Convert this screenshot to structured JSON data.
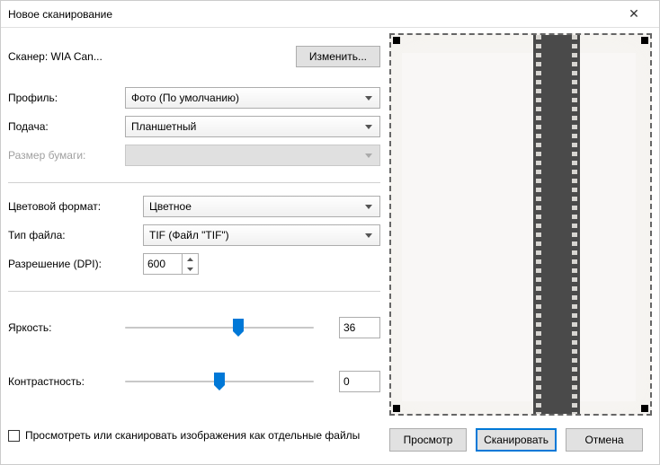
{
  "window": {
    "title": "Новое сканирование"
  },
  "scanner": {
    "label": "Сканер: WIA Can...",
    "change_btn": "Изменить..."
  },
  "profile": {
    "label": "Профиль:",
    "value": "Фото (По умолчанию)"
  },
  "source": {
    "label": "Подача:",
    "value": "Планшетный"
  },
  "paper": {
    "label": "Размер бумаги:",
    "value": ""
  },
  "color": {
    "label": "Цветовой формат:",
    "value": "Цветное"
  },
  "filetype": {
    "label": "Тип файла:",
    "value": "TIF (Файл \"TIF\")"
  },
  "dpi": {
    "label": "Разрешение (DPI):",
    "value": "600"
  },
  "brightness": {
    "label": "Яркость:",
    "value": "36",
    "pos_pct": 60
  },
  "contrast": {
    "label": "Контрастность:",
    "value": "0",
    "pos_pct": 50
  },
  "separate_files": {
    "label": "Просмотреть или сканировать изображения как отдельные файлы",
    "checked": false
  },
  "buttons": {
    "preview": "Просмотр",
    "scan": "Сканировать",
    "cancel": "Отмена"
  }
}
